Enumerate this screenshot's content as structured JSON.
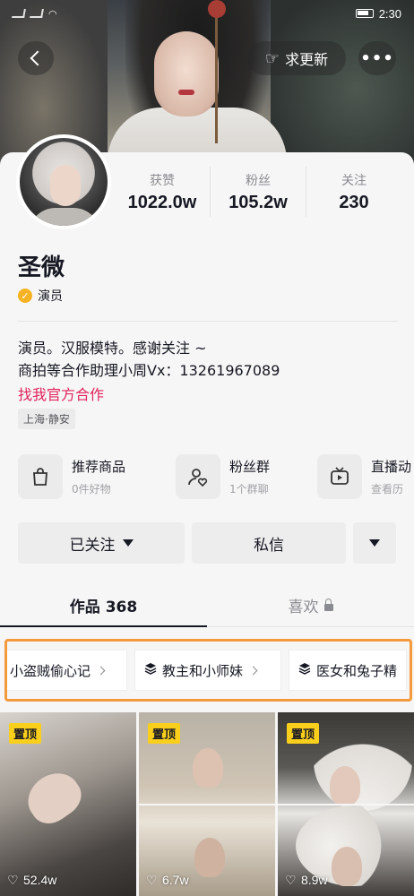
{
  "statusbar": {
    "time": "2:30"
  },
  "nav": {
    "update_label": "求更新",
    "more_label": "•••"
  },
  "profile": {
    "name": "圣微",
    "verify_label": "演员",
    "stats": [
      {
        "label": "获赞",
        "value": "1022.0w"
      },
      {
        "label": "粉丝",
        "value": "105.2w"
      },
      {
        "label": "关注",
        "value": "230"
      }
    ],
    "bio_lines": [
      "演员。汉服模特。感谢关注 ~",
      "商拍等合作助理小周Vx：13261967089"
    ],
    "coop_link": "找我官方合作",
    "location": "上海·静安"
  },
  "features": [
    {
      "title": "推荐商品",
      "sub": "0件好物",
      "icon": "shopping-bag-icon"
    },
    {
      "title": "粉丝群",
      "sub": "1个群聊",
      "icon": "fan-group-icon"
    },
    {
      "title": "直播动",
      "sub": "查看历",
      "icon": "tv-icon"
    }
  ],
  "actions": {
    "follow_label": "已关注",
    "message_label": "私信"
  },
  "tabs": [
    {
      "label": "作品 368",
      "active": true
    },
    {
      "label": "喜欢",
      "active": false
    }
  ],
  "collections": [
    {
      "label": "小盗贼偷心记"
    },
    {
      "label": "教主和小师妹"
    },
    {
      "label": "医女和兔子精"
    }
  ],
  "videos": [
    {
      "pin": "置顶",
      "likes": "52.4w"
    },
    {
      "pin": "置顶",
      "likes": "6.7w"
    },
    {
      "pin": "置顶",
      "likes": "8.9w"
    }
  ],
  "colors": {
    "accent_pink": "#e0245e",
    "pin_yellow": "#facf1c",
    "highlight_orange": "#f39a3c",
    "verify_gold": "#f5b323"
  }
}
